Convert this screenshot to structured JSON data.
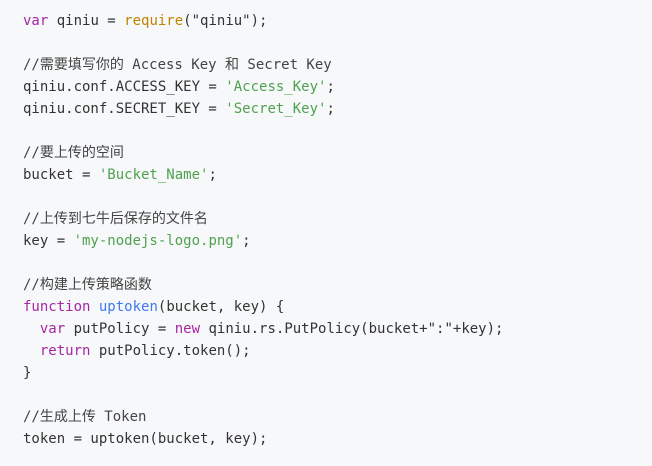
{
  "code_lines": [
    [
      {
        "t": "var",
        "c": "kw"
      },
      {
        "t": " qiniu = "
      },
      {
        "t": "require",
        "c": "builtin"
      },
      {
        "t": "(\"qiniu\");"
      }
    ],
    [],
    [
      {
        "t": "//需要填写你的 Access Key 和 Secret Key",
        "c": "cm"
      }
    ],
    [
      {
        "t": "qiniu.conf.ACCESS_KEY = "
      },
      {
        "t": "'Access_Key'",
        "c": "str"
      },
      {
        "t": ";"
      }
    ],
    [
      {
        "t": "qiniu.conf.SECRET_KEY = "
      },
      {
        "t": "'Secret_Key'",
        "c": "str"
      },
      {
        "t": ";"
      }
    ],
    [],
    [
      {
        "t": "//要上传的空间",
        "c": "cm"
      }
    ],
    [
      {
        "t": "bucket = "
      },
      {
        "t": "'Bucket_Name'",
        "c": "str"
      },
      {
        "t": ";"
      }
    ],
    [],
    [
      {
        "t": "//上传到七牛后保存的文件名",
        "c": "cm"
      }
    ],
    [
      {
        "t": "key = "
      },
      {
        "t": "'my-nodejs-logo.png'",
        "c": "str"
      },
      {
        "t": ";"
      }
    ],
    [],
    [
      {
        "t": "//构建上传策略函数",
        "c": "cm"
      }
    ],
    [
      {
        "t": "function",
        "c": "kw"
      },
      {
        "t": " "
      },
      {
        "t": "uptoken",
        "c": "fn"
      },
      {
        "t": "(bucket, key) {"
      }
    ],
    [
      {
        "t": "  "
      },
      {
        "t": "var",
        "c": "kw"
      },
      {
        "t": " putPolicy = "
      },
      {
        "t": "new",
        "c": "kw"
      },
      {
        "t": " qiniu.rs.PutPolicy(bucket+\":\"+key);"
      }
    ],
    [
      {
        "t": "  "
      },
      {
        "t": "return",
        "c": "kw"
      },
      {
        "t": " putPolicy.token();"
      }
    ],
    [
      {
        "t": "}"
      }
    ],
    [],
    [
      {
        "t": "//生成上传 Token",
        "c": "cm"
      }
    ],
    [
      {
        "t": "token = uptoken(bucket, key);"
      }
    ]
  ]
}
